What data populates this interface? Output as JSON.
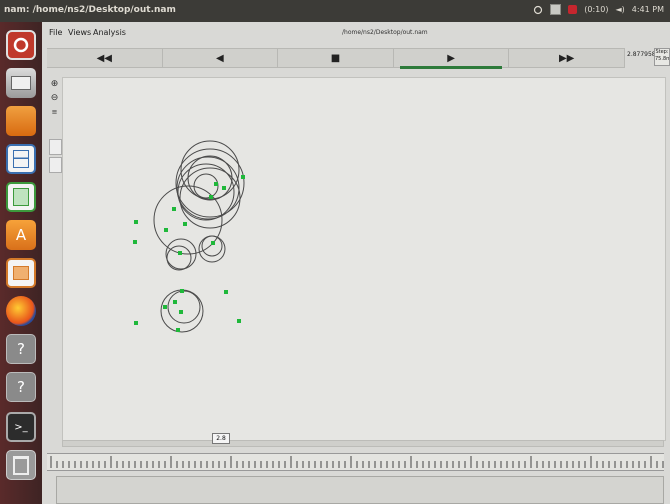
{
  "window": {
    "title": "nam: /home/ns2/Desktop/out.nam"
  },
  "system_tray": {
    "clock": "4:41 PM",
    "volume": "(0:10)"
  },
  "menu": {
    "file": "File",
    "views": "Views",
    "analysis": "Analysis"
  },
  "trace_path": "/home/ns2/Desktop/out.nam",
  "controls": {
    "rewind": "◀◀",
    "back": "◀",
    "stop": "■",
    "play": "▶",
    "fast_forward": "▶▶"
  },
  "sim_time": "2.877958",
  "step_label": "Step: 75.8ms",
  "timeline_marker": "2.8",
  "colors": {
    "node": "#1fb83a",
    "circle": "#4a4a4a",
    "play_indicator": "#2d7a3a"
  },
  "launcher": [
    "ubuntu-icon",
    "files-icon",
    "folder-icon",
    "writer-icon",
    "calc-icon",
    "software-center-icon",
    "impress-icon",
    "firefox-icon",
    "unknown-app-icon",
    "unknown-app-icon",
    "terminal-icon",
    "trash-icon"
  ]
}
